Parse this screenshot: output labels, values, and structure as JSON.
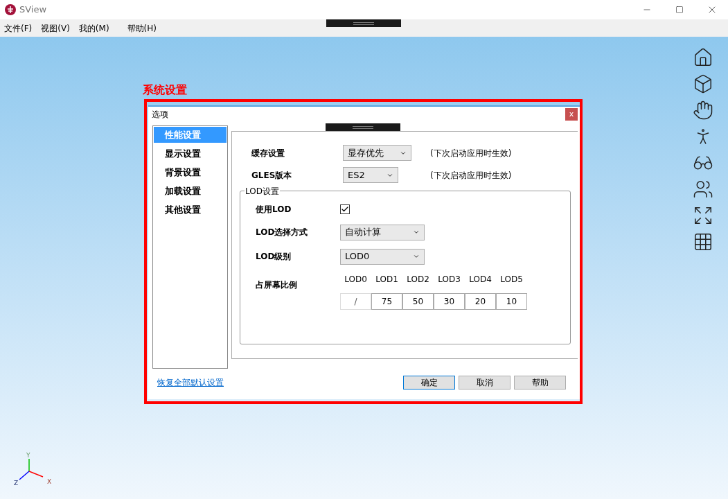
{
  "window": {
    "title": "SView"
  },
  "menu": [
    {
      "label": "文件(F)"
    },
    {
      "label": "视图(V)"
    },
    {
      "label": "我的(M)"
    },
    {
      "label": "帮助(H)"
    }
  ],
  "annotation": "系统设置",
  "dialog": {
    "title": "选项",
    "close": "x",
    "sidebar": [
      {
        "label": "性能设置",
        "selected": true
      },
      {
        "label": "显示设置",
        "selected": false
      },
      {
        "label": "背景设置",
        "selected": false
      },
      {
        "label": "加载设置",
        "selected": false
      },
      {
        "label": "其他设置",
        "selected": false
      }
    ],
    "fields": [
      {
        "label": "缓存设置",
        "value": "显存优先",
        "note": "(下次启动应用时生效)"
      },
      {
        "label": "GLES版本",
        "value": "ES2",
        "note": "(下次启动应用时生效)"
      }
    ],
    "lod": {
      "title": "LOD设置",
      "use_lod": {
        "label": "使用LOD",
        "checked": true
      },
      "selects": [
        {
          "label": "LOD选择方式",
          "value": "自动计算"
        },
        {
          "label": "LOD级别",
          "value": "LOD0"
        }
      ],
      "ratio": {
        "label": "占屏幕比例",
        "columns": [
          "LOD0",
          "LOD1",
          "LOD2",
          "LOD3",
          "LOD4",
          "LOD5"
        ],
        "values": [
          {
            "value": "/",
            "disabled": true
          },
          {
            "value": "75",
            "disabled": false
          },
          {
            "value": "50",
            "disabled": false
          },
          {
            "value": "30",
            "disabled": false
          },
          {
            "value": "20",
            "disabled": false
          },
          {
            "value": "10",
            "disabled": false
          }
        ]
      }
    },
    "reset_link": "恢复全部默认设置",
    "buttons": [
      {
        "label": "确定",
        "default": true
      },
      {
        "label": "取消",
        "default": false
      },
      {
        "label": "帮助",
        "default": false
      }
    ]
  },
  "axes": {
    "x": "X",
    "y": "Y",
    "z": "Z"
  }
}
